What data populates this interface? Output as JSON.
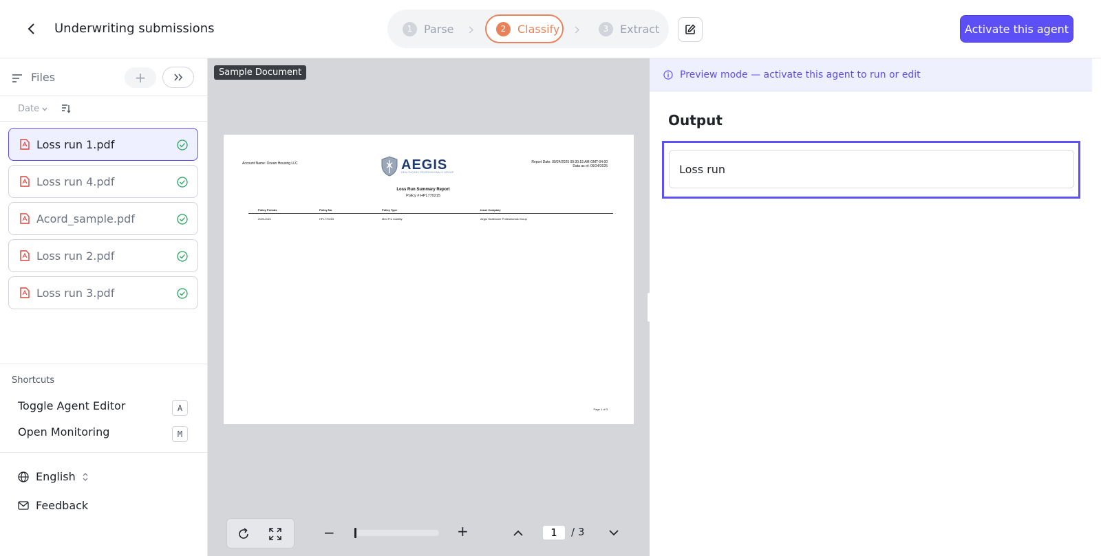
{
  "header": {
    "title": "Underwriting submissions",
    "steps": [
      {
        "num": "1",
        "label": "Parse"
      },
      {
        "num": "2",
        "label": "Classify"
      },
      {
        "num": "3",
        "label": "Extract"
      }
    ],
    "activate_label": "Activate this agent"
  },
  "sidebar": {
    "files_label": "Files",
    "sort_label": "Date",
    "files": [
      {
        "name": "Loss run 1.pdf",
        "active": true
      },
      {
        "name": "Loss run 4.pdf",
        "active": false
      },
      {
        "name": "Acord_sample.pdf",
        "active": false
      },
      {
        "name": "Loss run 2.pdf",
        "active": false
      },
      {
        "name": "Loss run 3.pdf",
        "active": false
      }
    ],
    "shortcuts_title": "Shortcuts",
    "shortcuts": [
      {
        "label": "Toggle Agent Editor",
        "key": "A"
      },
      {
        "label": "Open Monitoring",
        "key": "M"
      }
    ],
    "language": "English",
    "feedback": "Feedback"
  },
  "viewer": {
    "badge": "Sample Document",
    "document": {
      "account": "Account Name: Ocean Housing LLC",
      "report_date": "Report Date: 09/24/2025 09:30:15 AM GMT-04:00",
      "data_as_of": "Data as of: 09/24/2025",
      "logo_text": "AEGIS",
      "logo_sub": "HEALTHCARE PROFESSIONALS GROUP",
      "title": "Loss Run Summary Report",
      "policy": "Policy # HPL770215",
      "columns": [
        "Policy Periods",
        "Policy No",
        "Policy Type",
        "Issue Company"
      ],
      "row": [
        "2020-2021",
        "HPL770215",
        "Med Pro Liability",
        "Aegis Healthcare Professionals Group"
      ],
      "footer": "Page 1 of 3"
    },
    "page_current": "1",
    "page_total": "/ 3",
    "zoom_level": 0
  },
  "output": {
    "preview_message": "Preview mode — activate this agent to run or edit",
    "title": "Output",
    "value": "Loss run"
  },
  "colors": {
    "accent": "#5b4ff5",
    "step_active": "#e8825a",
    "success": "#22a45d",
    "pdf": "#d9453b"
  }
}
